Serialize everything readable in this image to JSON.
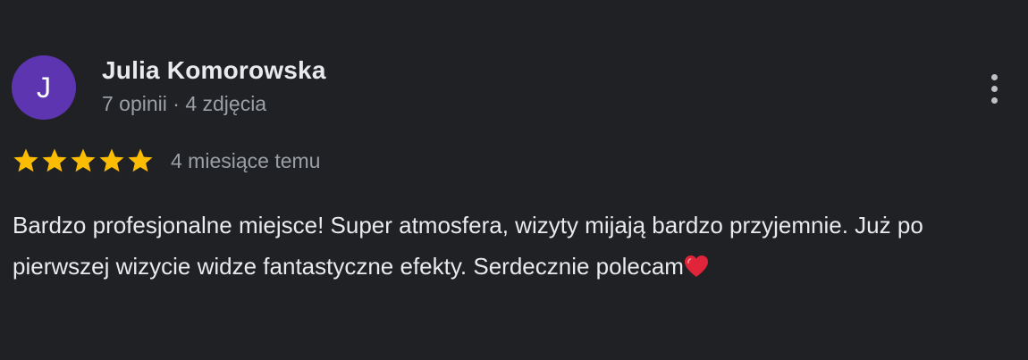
{
  "review": {
    "author": {
      "initial": "J",
      "name": "Julia Komorowska",
      "meta": "7 opinii · 4 zdjęcia",
      "avatar_color": "#5e35b1"
    },
    "rating": {
      "stars": 5,
      "max_stars": 5,
      "star_color": "#fbbc04"
    },
    "date": "4 miesiące temu",
    "text": "Bardzo profesjonalne miejsce! Super atmosfera, wizyty mijają bardzo przyjemnie. Już po pierwszej wizycie widze fantastyczne efekty. Serdecznie polecam",
    "emoji": "heart-icon",
    "more_icon": "more-vert-icon"
  }
}
